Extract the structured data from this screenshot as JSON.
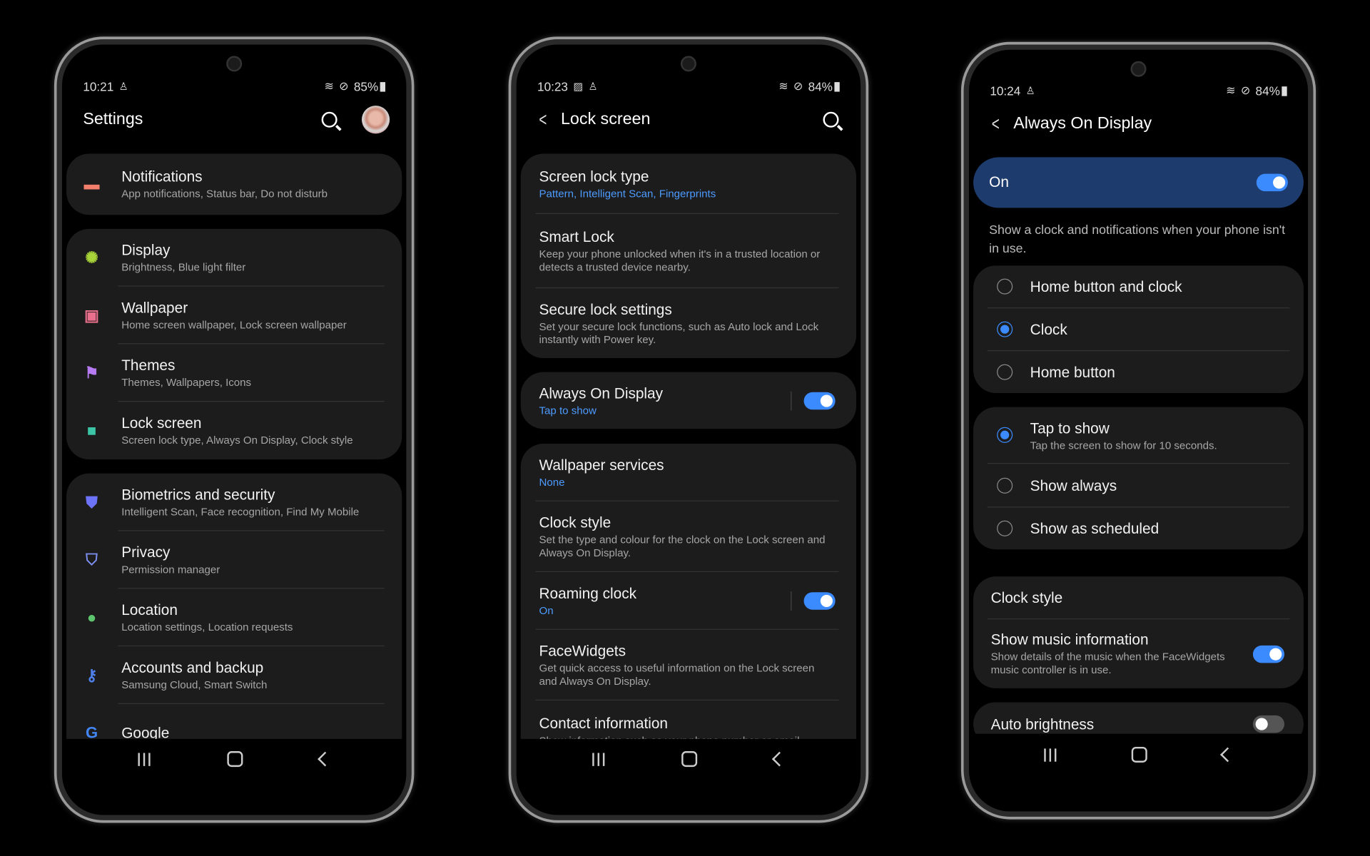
{
  "phones": [
    {
      "status": {
        "time": "10:21",
        "left_icons": [
          "accessibility-icon"
        ],
        "right_icons": [
          "wifi-icon",
          "do-not-disturb-icon"
        ],
        "battery": "85%"
      },
      "header": {
        "title": "Settings",
        "actions": [
          "search-icon",
          "avatar"
        ]
      },
      "groups": [
        [
          {
            "title": "Notifications",
            "sub": "App notifications, Status bar, Do not disturb",
            "icon": "notifications-icon",
            "color": "#f27e6c"
          }
        ],
        [
          {
            "title": "Display",
            "sub": "Brightness, Blue light filter",
            "icon": "display-sun-icon",
            "color": "#a8d43a"
          },
          {
            "title": "Wallpaper",
            "sub": "Home screen wallpaper, Lock screen wallpaper",
            "icon": "wallpaper-icon",
            "color": "#ea6f8c"
          },
          {
            "title": "Themes",
            "sub": "Themes, Wallpapers, Icons",
            "icon": "themes-brush-icon",
            "color": "#b67bf2"
          },
          {
            "title": "Lock screen",
            "sub": "Screen lock type, Always On Display, Clock style",
            "icon": "lock-icon",
            "color": "#3cc4a6"
          }
        ],
        [
          {
            "title": "Biometrics and security",
            "sub": "Intelligent Scan, Face recognition, Find My Mobile",
            "icon": "shield-icon",
            "color": "#6d73f6"
          },
          {
            "title": "Privacy",
            "sub": "Permission manager",
            "icon": "privacy-shield-icon",
            "color": "#7d8ff2"
          },
          {
            "title": "Location",
            "sub": "Location settings, Location requests",
            "icon": "location-pin-icon",
            "color": "#5cc46c"
          },
          {
            "title": "Accounts and backup",
            "sub": "Samsung Cloud, Smart Switch",
            "icon": "key-icon",
            "color": "#4f80ea"
          },
          {
            "title": "Google",
            "sub": "",
            "icon": "google-icon",
            "color": "#4285f4"
          }
        ]
      ]
    },
    {
      "status": {
        "time": "10:23",
        "left_icons": [
          "image-icon",
          "accessibility-icon"
        ],
        "right_icons": [
          "wifi-icon",
          "do-not-disturb-icon"
        ],
        "battery": "84%"
      },
      "header": {
        "title": "Lock screen",
        "actions": [
          "back-icon",
          "search-icon"
        ]
      },
      "groups": [
        [
          {
            "title": "Screen lock type",
            "sub": "Pattern, Intelligent Scan, Fingerprints",
            "accent": true
          },
          {
            "title": "Smart Lock",
            "sub": "Keep your phone unlocked when it's in a trusted location or detects a trusted device nearby."
          },
          {
            "title": "Secure lock settings",
            "sub": "Set your secure lock functions, such as Auto lock and Lock instantly with Power key."
          }
        ],
        [
          {
            "title": "Always On Display",
            "sub": "Tap to show",
            "accent": true,
            "toggle": true
          }
        ],
        [
          {
            "title": "Wallpaper services",
            "sub": "None",
            "accent": true
          },
          {
            "title": "Clock style",
            "sub": "Set the type and colour for the clock on the Lock screen and Always On Display."
          },
          {
            "title": "Roaming clock",
            "sub": "On",
            "accent": true,
            "toggle": true
          },
          {
            "title": "FaceWidgets",
            "sub": "Get quick access to useful information on the Lock screen and Always On Display."
          },
          {
            "title": "Contact information",
            "sub": "Show information such as your phone number or email"
          }
        ]
      ]
    },
    {
      "status": {
        "time": "10:24",
        "left_icons": [
          "accessibility-icon"
        ],
        "right_icons": [
          "wifi-icon",
          "do-not-disturb-icon"
        ],
        "battery": "84%"
      },
      "header": {
        "title": "Always On Display",
        "actions": [
          "back-icon"
        ]
      },
      "master": {
        "label": "On",
        "toggle": true
      },
      "description": "Show a clock and notifications when your phone isn't in use.",
      "groups": [
        [
          {
            "title": "Home button and clock",
            "radio": false
          },
          {
            "title": "Clock",
            "radio": true
          },
          {
            "title": "Home button",
            "radio": false
          }
        ],
        [
          {
            "title": "Tap to show",
            "sub": "Tap the screen to show for 10 seconds.",
            "radio": true
          },
          {
            "title": "Show always",
            "radio": false
          },
          {
            "title": "Show as scheduled",
            "radio": false
          }
        ],
        [
          {
            "title": "Clock style"
          },
          {
            "title": "Show music information",
            "sub": "Show details of the music when the FaceWidgets music controller is in use.",
            "toggle": true
          }
        ],
        [
          {
            "title": "Auto brightness",
            "toggle": false
          }
        ]
      ]
    }
  ],
  "nav": [
    "recents-icon",
    "home-icon",
    "back-icon"
  ],
  "colors": {
    "accent": "#3b8bff",
    "card": "#1c1c1c",
    "master_bar": "#1d3b6d"
  }
}
